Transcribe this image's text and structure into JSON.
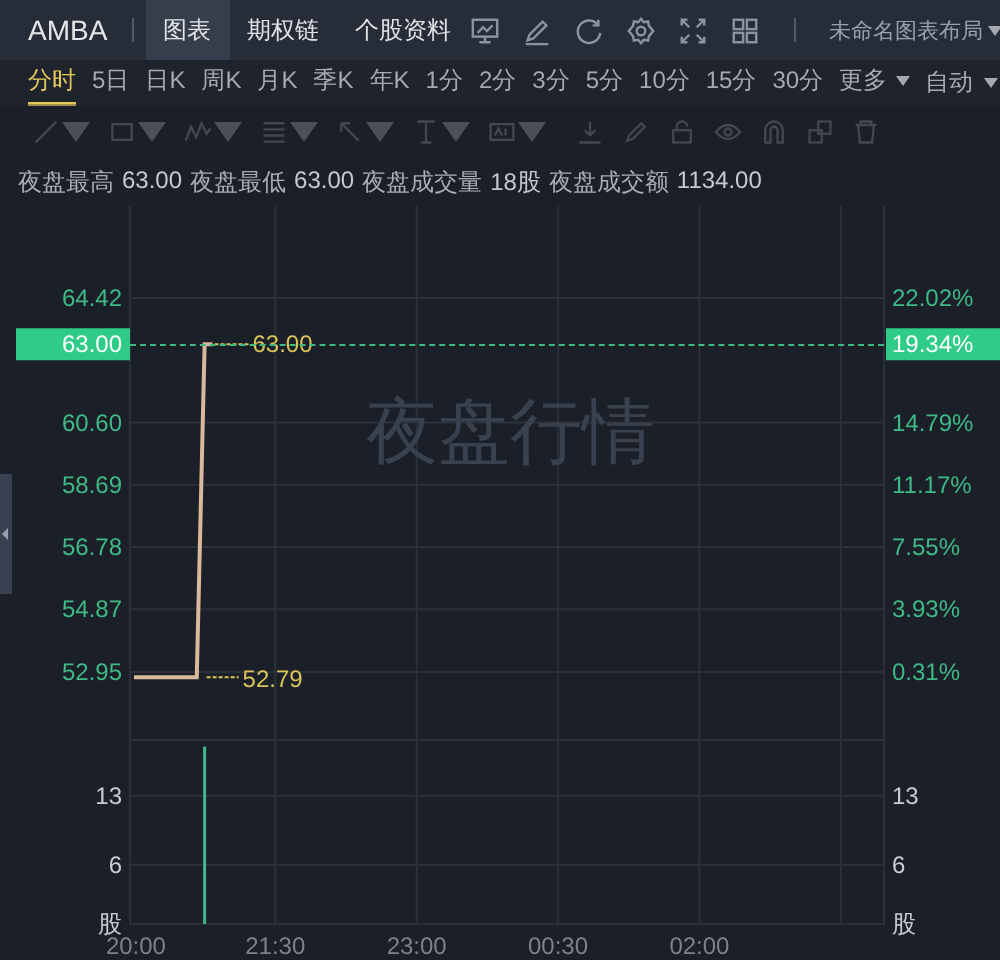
{
  "header": {
    "symbol": "AMBA",
    "tabs": [
      {
        "label": "图表",
        "selected": true
      },
      {
        "label": "期权链",
        "selected": false
      },
      {
        "label": "个股资料",
        "selected": false
      }
    ],
    "layout_menu": "未命名图表布局"
  },
  "periods": [
    {
      "label": "分时",
      "selected": true
    },
    {
      "label": "5日",
      "selected": false
    },
    {
      "label": "日K",
      "selected": false
    },
    {
      "label": "周K",
      "selected": false
    },
    {
      "label": "月K",
      "selected": false
    },
    {
      "label": "季K",
      "selected": false
    },
    {
      "label": "年K",
      "selected": false
    },
    {
      "label": "1分",
      "selected": false
    },
    {
      "label": "2分",
      "selected": false
    },
    {
      "label": "3分",
      "selected": false
    },
    {
      "label": "5分",
      "selected": false
    },
    {
      "label": "10分",
      "selected": false
    },
    {
      "label": "15分",
      "selected": false
    },
    {
      "label": "30分",
      "selected": false
    },
    {
      "label": "更多",
      "selected": false
    }
  ],
  "mode_menu": "自动",
  "drawing_toolbar": {
    "disabled": true
  },
  "stats": [
    {
      "label": "夜盘最高",
      "value": "63.00"
    },
    {
      "label": "夜盘最低",
      "value": "63.00"
    },
    {
      "label": "夜盘成交量",
      "value": "18股"
    },
    {
      "label": "夜盘成交额",
      "value": "1134.00"
    }
  ],
  "price_chart": {
    "overlay_text": "夜盘行情",
    "current_price": "63.00",
    "current_change": "19.34%",
    "point_labels": [
      "63.00",
      "52.79"
    ],
    "right_ticks": [
      "22.02%",
      "14.79%",
      "11.17%",
      "7.55%",
      "3.93%",
      "0.31%"
    ],
    "chart_data": {
      "type": "line",
      "categories": [
        null,
        null,
        null,
        null,
        null,
        null,
        null,
        null,
        null,
        null,
        null,
        null,
        null,
        null,
        null,
        null,
        null,
        null,
        null,
        null,
        null,
        null,
        null,
        null,
        null,
        null,
        null,
        null,
        null,
        null,
        null,
        null,
        null,
        null,
        null,
        null,
        null,
        null,
        null,
        null,
        null,
        null,
        null,
        null,
        null,
        null,
        null,
        null,
        null,
        null,
        null,
        null,
        null,
        null,
        null,
        null,
        null,
        null,
        null,
        null,
        null,
        null,
        null,
        null,
        null,
        null,
        null,
        null,
        null,
        null,
        null,
        null,
        null,
        null,
        null,
        null,
        null,
        null,
        null,
        null,
        null,
        null,
        null,
        null,
        null,
        null,
        null,
        null,
        null,
        null,
        null,
        null,
        null,
        null,
        null,
        null
      ],
      "series": [
        {
          "color": "#d9b99b",
          "values": [
            52.79,
            52.79,
            52.79,
            52.79,
            52.79,
            52.79,
            52.79,
            52.79,
            52.79,
            63.0,
            63.0,
            null,
            null,
            null,
            null,
            null,
            null,
            null,
            null,
            null,
            null,
            null,
            null,
            null,
            null,
            null,
            null,
            null,
            null,
            null,
            null,
            null,
            null,
            null,
            null,
            null,
            null,
            null,
            null,
            null,
            null,
            null,
            null,
            null,
            null,
            null,
            null,
            null,
            null,
            null,
            null,
            null,
            null,
            null,
            null,
            null,
            null,
            null,
            null,
            null,
            null,
            null,
            null,
            null,
            null,
            null,
            null,
            null,
            null,
            null,
            null,
            null,
            null,
            null,
            null,
            null,
            null,
            null,
            null,
            null,
            null,
            null,
            null,
            null,
            null,
            null,
            null,
            null,
            null,
            null,
            null,
            null,
            null,
            null,
            null,
            null
          ]
        }
      ],
      "ylim": [
        51.6,
        67.24
      ],
      "grid": true,
      "yticks": [
        {
          "value": 64.42,
          "label": "64.42"
        },
        {
          "value": 60.6,
          "label": "60.60"
        },
        {
          "value": 58.69,
          "label": "58.69"
        },
        {
          "value": 56.78,
          "label": "56.78"
        },
        {
          "value": 54.87,
          "label": "54.87"
        },
        {
          "value": 52.95,
          "label": "52.95"
        }
      ]
    }
  },
  "volume_chart": {
    "right_ticks": [
      "13",
      "6",
      "股"
    ],
    "chart_data": {
      "type": "bar",
      "categories": [
        "20:00",
        null,
        null,
        null,
        null,
        null,
        null,
        null,
        null,
        null,
        null,
        null,
        null,
        null,
        null,
        null,
        null,
        null,
        "21:30",
        null,
        null,
        null,
        null,
        null,
        null,
        null,
        null,
        null,
        null,
        null,
        null,
        null,
        null,
        null,
        null,
        null,
        "23:00",
        null,
        null,
        null,
        null,
        null,
        null,
        null,
        null,
        null,
        null,
        null,
        null,
        null,
        null,
        null,
        null,
        null,
        "00:30",
        null,
        null,
        null,
        null,
        null,
        null,
        null,
        null,
        null,
        null,
        null,
        null,
        null,
        null,
        null,
        null,
        null,
        "02:00",
        null,
        null,
        null,
        null,
        null,
        null,
        null,
        null,
        null,
        null,
        null,
        null,
        null,
        null,
        null,
        null,
        null,
        null,
        null,
        null,
        null,
        null,
        null
      ],
      "values": [
        null,
        null,
        null,
        null,
        null,
        null,
        null,
        null,
        null,
        18,
        null,
        null,
        null,
        null,
        null,
        null,
        null,
        null,
        null,
        null,
        null,
        null,
        null,
        null,
        null,
        null,
        null,
        null,
        null,
        null,
        null,
        null,
        null,
        null,
        null,
        null,
        null,
        null,
        null,
        null,
        null,
        null,
        null,
        null,
        null,
        null,
        null,
        null,
        null,
        null,
        null,
        null,
        null,
        null,
        null,
        null,
        null,
        null,
        null,
        null,
        null,
        null,
        null,
        null,
        null,
        null,
        null,
        null,
        null,
        null,
        null,
        null,
        null,
        null,
        null,
        null,
        null,
        null,
        null,
        null,
        null,
        null,
        null,
        null,
        null,
        null,
        null,
        null,
        null,
        null,
        null,
        null,
        null,
        null,
        null,
        null
      ],
      "ylim": [
        0,
        21.1
      ],
      "grid": true,
      "yticks": [
        {
          "value": 13,
          "label": "13"
        },
        {
          "value": 6,
          "label": "6"
        },
        {
          "value": 0,
          "label": "股"
        }
      ]
    }
  }
}
